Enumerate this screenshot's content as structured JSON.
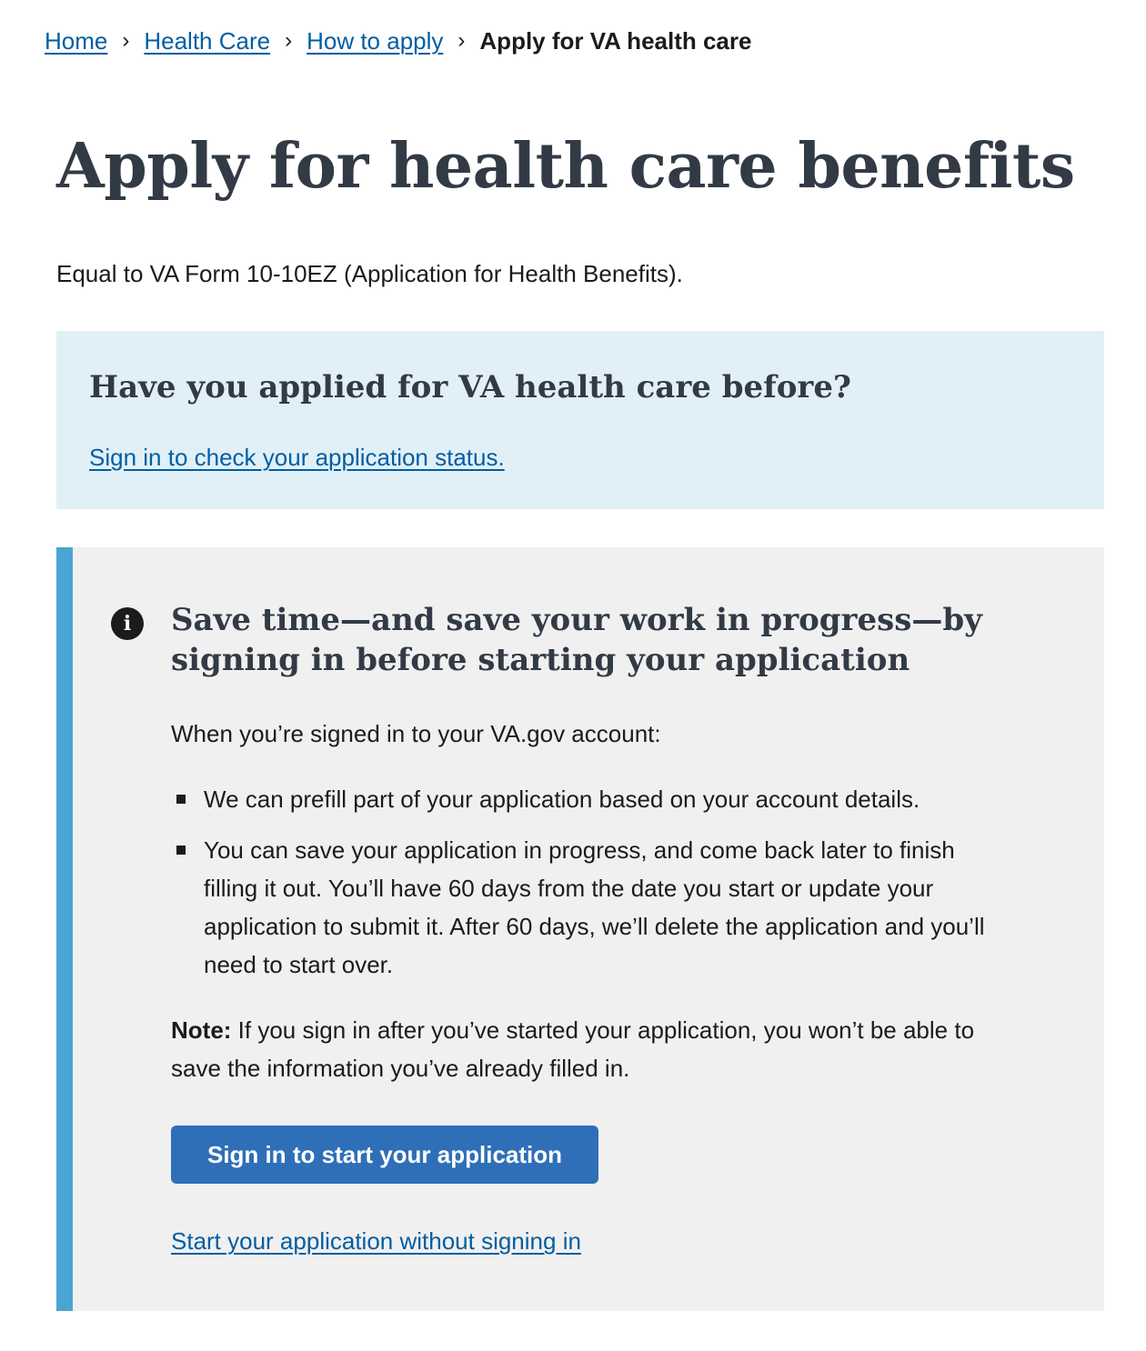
{
  "breadcrumb": {
    "items": [
      {
        "label": "Home"
      },
      {
        "label": "Health Care"
      },
      {
        "label": "How to apply"
      }
    ],
    "current": "Apply for VA health care",
    "separator": "›"
  },
  "page": {
    "title": "Apply for health care benefits",
    "subtitle": "Equal to VA Form 10-10EZ (Application for Health Benefits)."
  },
  "applied_before": {
    "heading": "Have you applied for VA health care before?",
    "link": "Sign in to check your application status."
  },
  "info_alert": {
    "icon": "info-icon",
    "icon_glyph": "i",
    "heading": "Save time—and save your work in progress—by signing in before starting your application",
    "intro": "When you’re signed in to your VA.gov account:",
    "bullets": [
      "We can prefill part of your application based on your account details.",
      "You can save your application in progress, and come back later to finish filling it out. You’ll have 60 days from the date you start or update your application to submit it. After 60 days, we’ll delete the application and you’ll need to start over."
    ],
    "note_label": "Note:",
    "note_text": " If you sign in after you’ve started your application, you won’t be able to save the information you’ve already filled in.",
    "primary_button": "Sign in to start your application",
    "secondary_link": "Start your application without signing in"
  },
  "colors": {
    "link": "#005ea2",
    "heading": "#323a45",
    "applied_bg": "#e1f0f7",
    "alert_bg": "#f0f0f0",
    "alert_border": "#4aa5d4",
    "button_bg": "#2e6fb8"
  }
}
